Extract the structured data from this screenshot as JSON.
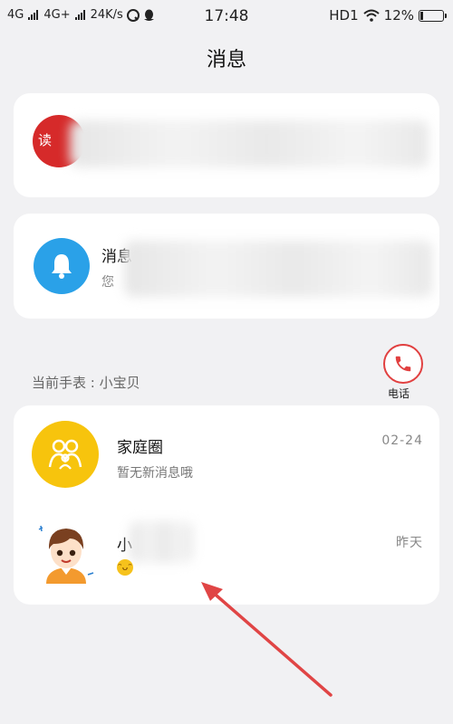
{
  "status_bar": {
    "network1": "4G",
    "network2": "4G+",
    "speed": "24K/s",
    "time": "17:48",
    "hd": "HD1",
    "battery": "12%",
    "battery_level": 0.12
  },
  "page_title": "消息",
  "reading_card": {
    "badge_text": "读"
  },
  "notification_card": {
    "title": "消息",
    "subtitle": "您"
  },
  "watch_label": "当前手表 : 小宝贝",
  "phone_button": {
    "label": "电话"
  },
  "chats": [
    {
      "name": "家庭圈",
      "subtitle": "暂无新消息哦",
      "time": "02-24",
      "icon": "family-icon"
    },
    {
      "name": "小",
      "subtitle": "",
      "time": "昨天",
      "icon": "avatar-boy"
    }
  ],
  "colors": {
    "background": "#f1f1f3",
    "reading_badge": "#d62a2a",
    "notification_icon_bg": "#2aa1e8",
    "family_icon_bg": "#f7c40d",
    "phone_accent": "#e14040",
    "arrow": "#e04545"
  }
}
